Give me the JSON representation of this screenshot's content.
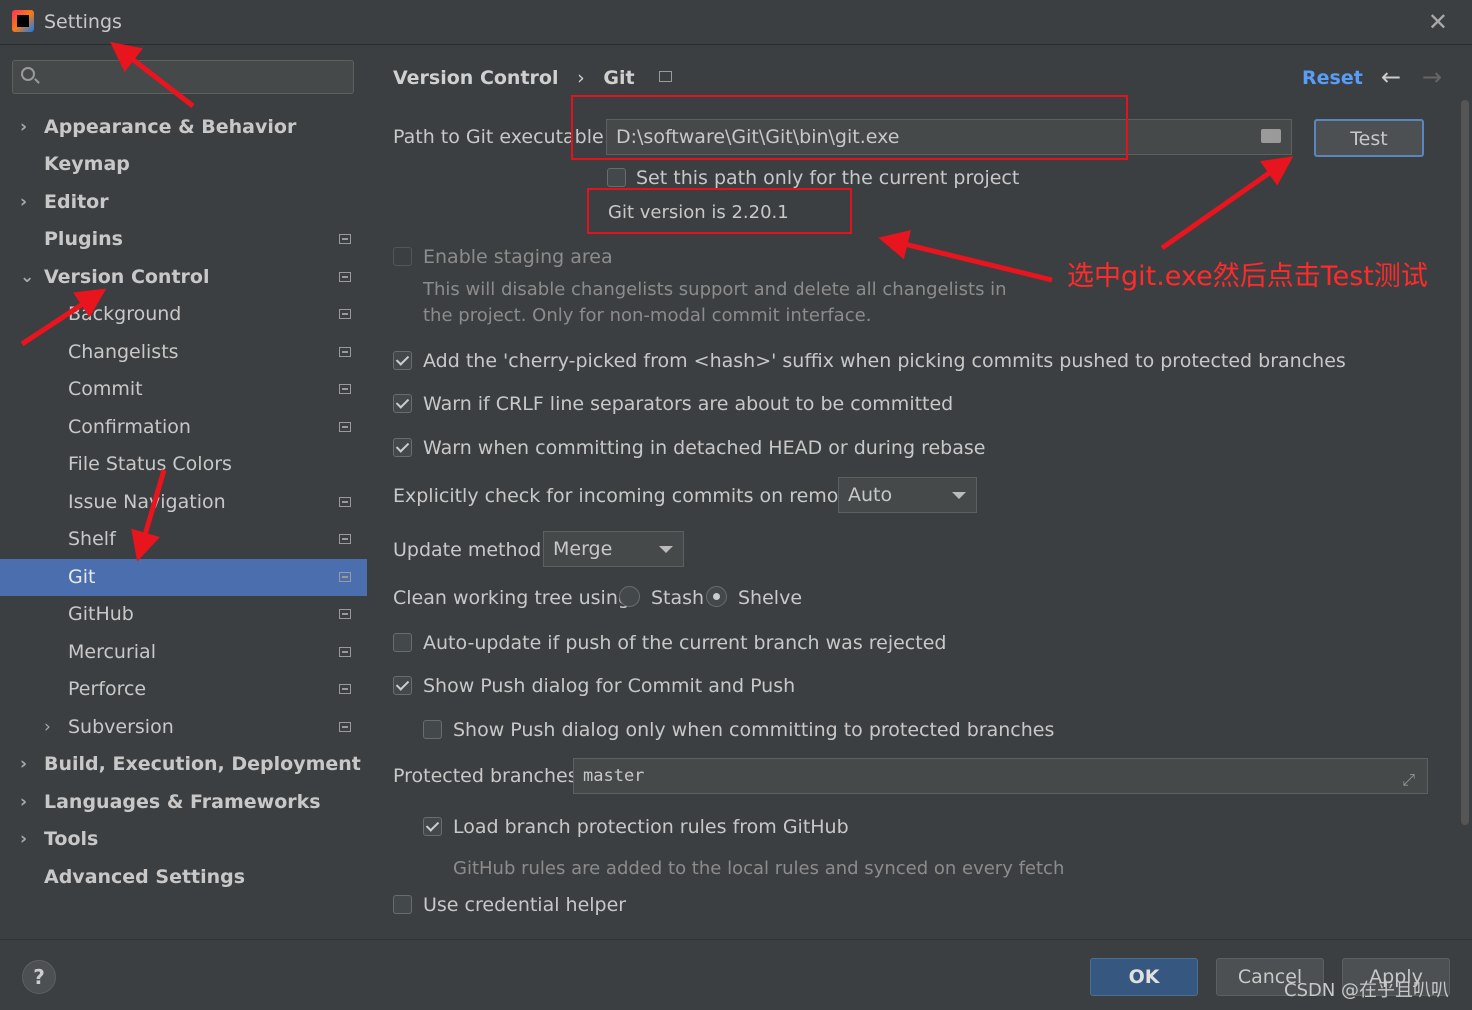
{
  "window": {
    "title": "Settings"
  },
  "sidebar": {
    "search": {
      "placeholder": ""
    },
    "items": [
      {
        "label": "Appearance & Behavior",
        "chevron": "›"
      },
      {
        "label": "Keymap"
      },
      {
        "label": "Editor",
        "chevron": "›"
      },
      {
        "label": "Plugins"
      },
      {
        "label": "Version Control",
        "chevron": "⌄"
      },
      {
        "label": "Background"
      },
      {
        "label": "Changelists"
      },
      {
        "label": "Commit"
      },
      {
        "label": "Confirmation"
      },
      {
        "label": "File Status Colors"
      },
      {
        "label": "Issue Navigation"
      },
      {
        "label": "Shelf"
      },
      {
        "label": "Git"
      },
      {
        "label": "GitHub"
      },
      {
        "label": "Mercurial"
      },
      {
        "label": "Perforce"
      },
      {
        "label": "Subversion",
        "chevron": "›"
      },
      {
        "label": "Build, Execution, Deployment",
        "chevron": "›"
      },
      {
        "label": "Languages & Frameworks",
        "chevron": "›"
      },
      {
        "label": "Tools",
        "chevron": "›"
      },
      {
        "label": "Advanced Settings"
      }
    ]
  },
  "header": {
    "breadcrumb_parent": "Version Control",
    "breadcrumb_sep": "›",
    "breadcrumb_current": "Git",
    "reset": "Reset",
    "back": "←",
    "forward": "→"
  },
  "git": {
    "path_label": "Path to Git executable:",
    "path_value": "D:\\software\\Git\\Git\\bin\\git.exe",
    "test_button": "Test",
    "project_only": "Set this path only for the current project",
    "version": "Git version is 2.20.1",
    "staging": "Enable staging area",
    "staging_desc_1": "This will disable changelists support and delete all changelists in",
    "staging_desc_2": "the project. Only for non-modal commit interface.",
    "cherry": "Add the 'cherry-picked from <hash>' suffix when picking commits pushed to protected branches",
    "crlf": "Warn if CRLF line separators are about to be committed",
    "detached": "Warn when committing in detached HEAD or during rebase",
    "incoming_label": "Explicitly check for incoming commits on remotes:",
    "incoming_value": "Auto",
    "update_label": "Update method:",
    "update_value": "Merge",
    "clean_label": "Clean working tree using:",
    "stash": "Stash",
    "shelve": "Shelve",
    "autoupdate": "Auto-update if push of the current branch was rejected",
    "push_dialog": "Show Push dialog for Commit and Push",
    "push_protected": "Show Push dialog only when committing to protected branches",
    "protected_label": "Protected branches:",
    "protected_value": "master",
    "github_rules": "Load branch protection rules from GitHub",
    "github_desc": "GitHub rules are added to the local rules and synced on every fetch",
    "credential": "Use credential helper"
  },
  "annotation": {
    "text": "选中git.exe然后点击Test测试"
  },
  "footer": {
    "help": "?",
    "ok": "OK",
    "cancel": "Cancel",
    "apply": "Apply",
    "watermark": "CSDN @在乎且叭叭"
  }
}
